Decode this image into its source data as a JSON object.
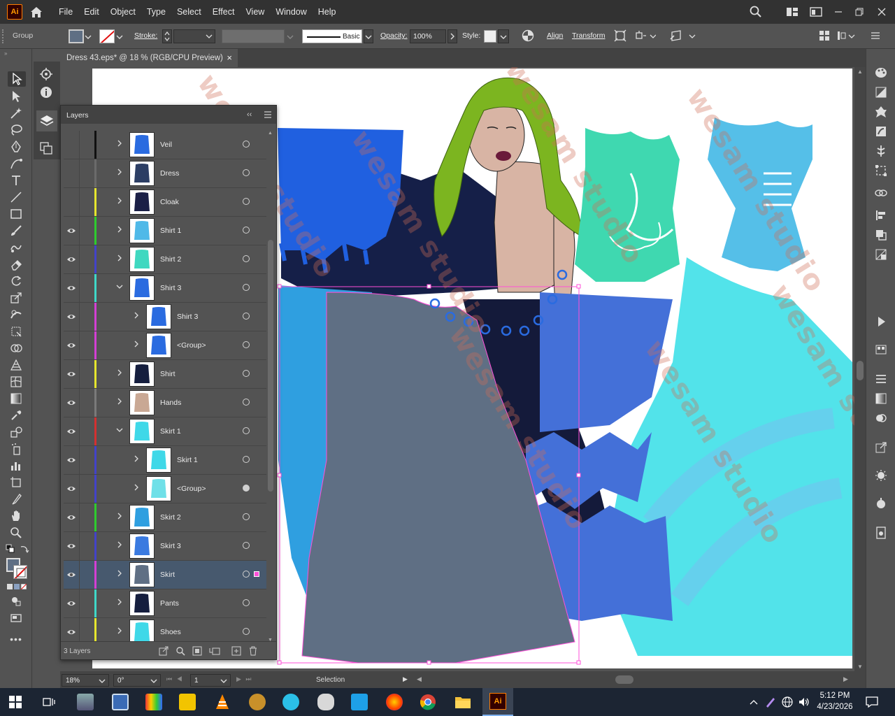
{
  "app": {
    "logo_text": "Ai",
    "brand_color": "#ff9a00"
  },
  "menu": [
    "File",
    "Edit",
    "Object",
    "Type",
    "Select",
    "Effect",
    "View",
    "Window",
    "Help"
  ],
  "control_bar": {
    "selection_type": "Group",
    "stroke_label": "Stroke:",
    "brush_label": "Basic",
    "opacity_label": "Opacity:",
    "opacity_value": "100%",
    "style_label": "Style:",
    "align_label": "Align",
    "transform_label": "Transform"
  },
  "document_tab": {
    "title": "Dress 43.eps* @ 18 % (RGB/CPU Preview)",
    "close": "×"
  },
  "layers_panel": {
    "title": "Layers",
    "collapse": "‹‹",
    "layers": [
      {
        "name": "Veil",
        "visible": false,
        "color": "#111111",
        "expanded": false,
        "indent": 0,
        "thumb": "#2a6be0"
      },
      {
        "name": "Dress",
        "visible": false,
        "color": "#6b6b6b",
        "expanded": false,
        "indent": 0,
        "thumb": "#2c3e64"
      },
      {
        "name": "Cloak",
        "visible": false,
        "color": "#e6e62e",
        "expanded": false,
        "indent": 0,
        "thumb": "#1a1f46"
      },
      {
        "name": "Shirt 1",
        "visible": true,
        "color": "#2ecc2e",
        "expanded": false,
        "indent": 0,
        "thumb": "#4fb9e8"
      },
      {
        "name": "Shirt 2",
        "visible": true,
        "color": "#4343c8",
        "expanded": false,
        "indent": 0,
        "thumb": "#3fd8c0"
      },
      {
        "name": "Shirt 3",
        "visible": true,
        "color": "#3fd8c8",
        "expanded": true,
        "indent": 0,
        "thumb": "#2a6be0"
      },
      {
        "name": "Shirt 3",
        "visible": true,
        "color": "#d43fd4",
        "expanded": false,
        "indent": 1,
        "thumb": "#2a6be0"
      },
      {
        "name": "<Group>",
        "visible": true,
        "color": "#d43fd4",
        "expanded": false,
        "indent": 1,
        "thumb": "#2a6be0"
      },
      {
        "name": "Shirt",
        "visible": true,
        "color": "#e6e62e",
        "expanded": false,
        "indent": 0,
        "thumb": "#151e3e"
      },
      {
        "name": "Hands",
        "visible": true,
        "color": "#7a7a7a",
        "expanded": false,
        "indent": 0,
        "thumb": "#c9a894"
      },
      {
        "name": "Skirt 1",
        "visible": true,
        "color": "#d43030",
        "expanded": true,
        "indent": 0,
        "thumb": "#3fd8e8"
      },
      {
        "name": "Skirt 1",
        "visible": true,
        "color": "#4343c8",
        "expanded": false,
        "indent": 1,
        "thumb": "#3fd8e8"
      },
      {
        "name": "<Group>",
        "visible": true,
        "color": "#4343c8",
        "expanded": false,
        "indent": 1,
        "thumb": "#6fe0e8"
      },
      {
        "name": "Skirt 2",
        "visible": true,
        "color": "#2ecc2e",
        "expanded": false,
        "indent": 0,
        "thumb": "#2f9fe0"
      },
      {
        "name": "Skirt 3",
        "visible": true,
        "color": "#4343c8",
        "expanded": false,
        "indent": 0,
        "thumb": "#3a7ae0"
      },
      {
        "name": "Skirt",
        "visible": true,
        "color": "#d43fd4",
        "expanded": false,
        "indent": 0,
        "thumb": "#5f6f84",
        "selected": true
      },
      {
        "name": "Pants",
        "visible": true,
        "color": "#3fd8c8",
        "expanded": false,
        "indent": 0,
        "thumb": "#151e3e"
      },
      {
        "name": "Shoes",
        "visible": true,
        "color": "#e6e62e",
        "expanded": false,
        "indent": 0,
        "thumb": "#3fd8e8"
      }
    ],
    "footer_count": "3 Layers"
  },
  "status_bar": {
    "zoom": "18%",
    "rotation": "0°",
    "artboard": "1",
    "tool": "Selection"
  },
  "taskbar": {
    "time": "5:12 PM",
    "date": "4/23/2026"
  },
  "watermark": "wesam studio"
}
